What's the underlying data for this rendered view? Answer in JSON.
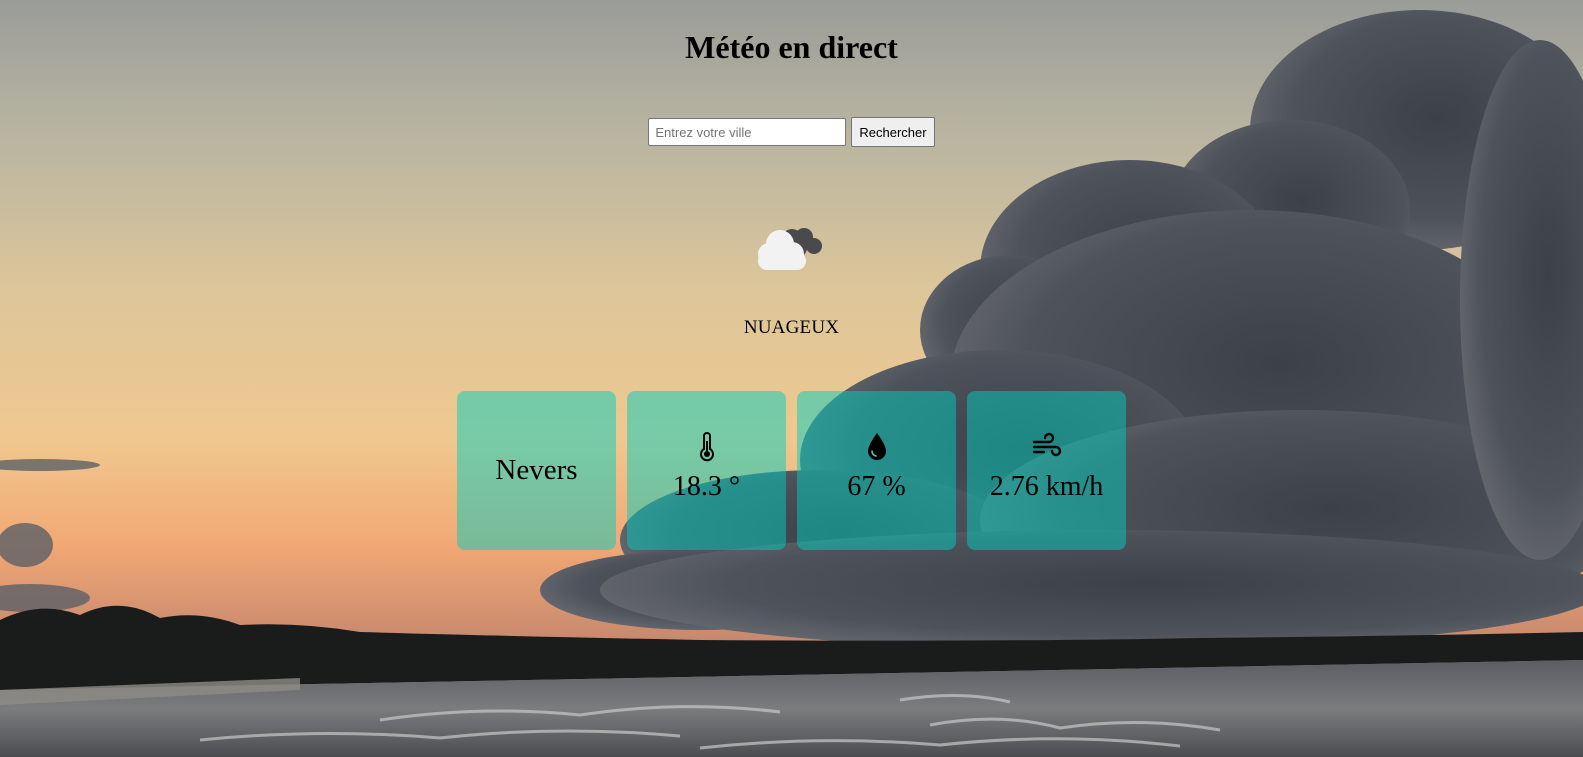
{
  "header": {
    "title": "Météo en direct"
  },
  "search": {
    "placeholder": "Entrez votre ville",
    "value": "",
    "button_label": "Rechercher"
  },
  "weather": {
    "icon": "cloudy-icon",
    "condition": "NUAGEUX"
  },
  "cards": {
    "city": "Nevers",
    "temperature": {
      "icon": "thermometer-icon",
      "value": "18.3 °"
    },
    "humidity": {
      "icon": "water-drop-icon",
      "value": "67 %"
    },
    "wind": {
      "icon": "wind-icon",
      "value": "2.76 km/h"
    }
  },
  "colors": {
    "card_background": "#00cdbe80",
    "text": "#000000"
  }
}
